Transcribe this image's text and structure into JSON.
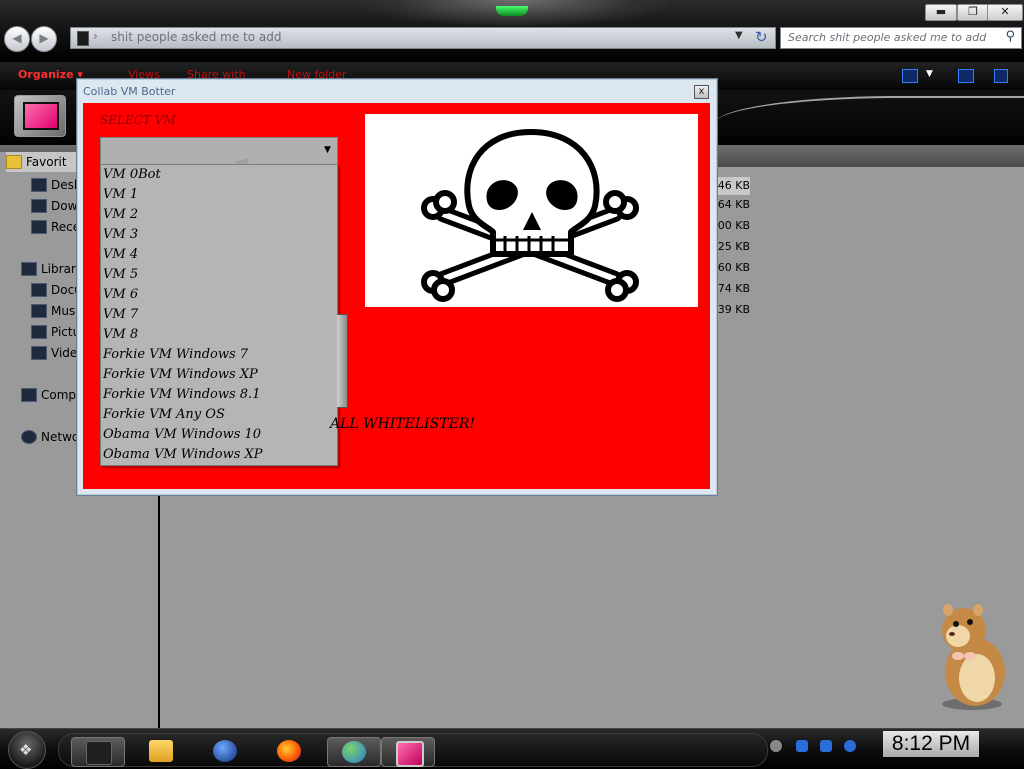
{
  "explorer": {
    "address_path": "shit people asked me to add",
    "search_placeholder": "Search shit people asked me to add",
    "commands": {
      "organize": "Organize",
      "views": "Views",
      "share": "Share with",
      "new_folder": "New folder"
    },
    "nav_pane": {
      "favorites": "Favorit",
      "desktop": "Desk",
      "downloads": "Dow",
      "recent": "Rece",
      "libraries": "Librari",
      "documents": "Docu",
      "music": "Musi",
      "pictures": "Pictu",
      "videos": "Vide",
      "computer": "Comp",
      "network": "Netwo"
    },
    "file_sizes": [
      "46 KB",
      "64 KB",
      "00 KB",
      "25 KB",
      "60 KB",
      "74 KB",
      "39 KB"
    ]
  },
  "dialog": {
    "title": "Collab VM Botter",
    "close_label": "x",
    "select_label": "SELECT VM",
    "selected_vm": "",
    "vm_options": [
      "VM 0Bot",
      "VM 1",
      "VM 2",
      "VM 3",
      "VM 4",
      "VM 5",
      "VM 6",
      "VM 7",
      "VM 8",
      "Forkie VM Windows 7",
      "Forkie VM Windows XP",
      "Forkie VM Windows 8.1",
      "Forkie VM Any OS",
      "Obama VM Windows 10",
      "Obama VM Windows XP"
    ],
    "whitelister_text": "ALL WHITELISTER!",
    "accent_color": "#ff0000"
  },
  "taskbar": {
    "clock": "8:12 PM",
    "apps": [
      "explorer-icon",
      "media-player-icon",
      "globe-icon",
      "firefox-icon",
      "messenger-icon",
      "collab-vm-botter-icon"
    ]
  }
}
